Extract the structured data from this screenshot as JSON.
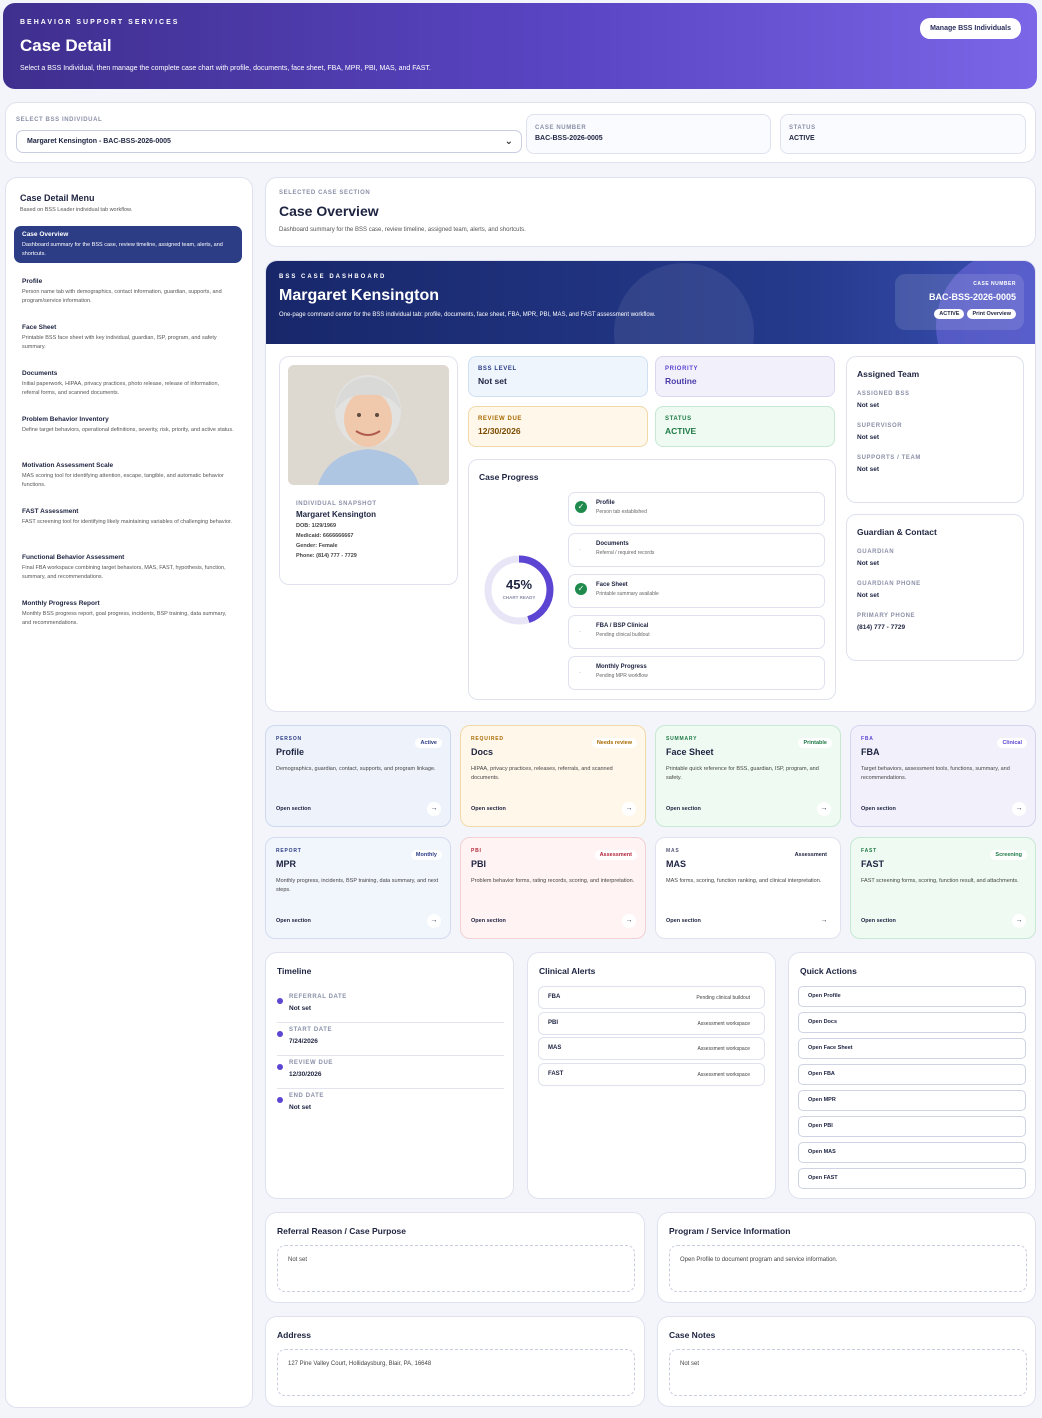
{
  "header": {
    "kicker": "BEHAVIOR SUPPORT SERVICES",
    "title": "Case Detail",
    "subtitle": "Select a BSS Individual, then manage the complete case chart with profile, documents, face sheet, FBA, MPR, PBI, MAS, and FAST.",
    "manage_button": "Manage BSS Individuals"
  },
  "selector": {
    "label": "SELECT BSS INDIVIDUAL",
    "value": "Margaret Kensington - BAC-BSS-2026-0005",
    "case_number_label": "CASE NUMBER",
    "case_number": "BAC-BSS-2026-0005",
    "status_label": "STATUS",
    "status": "ACTIVE"
  },
  "sidebar": {
    "title": "Case Detail Menu",
    "subtitle": "Based on BSS Leader individual tab workflow.",
    "items": [
      {
        "label": "Case Overview",
        "desc": "Dashboard summary for the BSS case, review timeline, assigned team, alerts, and shortcuts."
      },
      {
        "label": "Profile",
        "desc": "Person name tab with demographics, contact information, guardian, supports, and program/service information."
      },
      {
        "label": "Face Sheet",
        "desc": "Printable BSS face sheet with key individual, guardian, ISP, program, and safety summary."
      },
      {
        "label": "Documents",
        "desc": "Initial paperwork, HIPAA, privacy practices, photo release, release of information, referral forms, and scanned documents."
      },
      {
        "label": "Problem Behavior Inventory",
        "desc": "Define target behaviors, operational definitions, severity, risk, priority, and active status."
      },
      {
        "label": "Motivation Assessment Scale",
        "desc": "MAS scoring tool for identifying attention, escape, tangible, and automatic behavior functions."
      },
      {
        "label": "FAST Assessment",
        "desc": "FAST screening tool for identifying likely maintaining variables of challenging behavior."
      },
      {
        "label": "Functional Behavior Assessment",
        "desc": "Final FBA workspace combining target behaviors, MAS, FAST, hypothesis, function, summary, and recommendations."
      },
      {
        "label": "Monthly Progress Report",
        "desc": "Monthly BSS progress report, goal progress, incidents, BSP training, data summary, and recommendations."
      }
    ]
  },
  "overview": {
    "kicker": "SELECTED CASE SECTION",
    "title": "Case Overview",
    "desc": "Dashboard summary for the BSS case, review timeline, assigned team, alerts, and shortcuts."
  },
  "dashboard": {
    "kicker": "BSS CASE DASHBOARD",
    "name": "Margaret Kensington",
    "desc": "One-page command center for the BSS individual tab: profile, documents, face sheet, FBA, MPR, PBI, MAS, and FAST assessment workflow.",
    "case_number_label": "CASE NUMBER",
    "case_number": "BAC-BSS-2026-0005",
    "active_pill": "ACTIVE",
    "print_pill": "Print Overview"
  },
  "snapshot": {
    "label": "INDIVIDUAL SNAPSHOT",
    "name": "Margaret Kensington",
    "dob": "DOB: 1/29/1969",
    "medicaid": "Medicaid: 6666666667",
    "gender": "Gender: Female",
    "phone": "Phone: (814) 777 - 7729"
  },
  "stats": {
    "bss_level_label": "BSS LEVEL",
    "bss_level": "Not set",
    "priority_label": "PRIORITY",
    "priority": "Routine",
    "review_due_label": "REVIEW DUE",
    "review_due": "12/30/2026",
    "status_label": "STATUS",
    "status": "ACTIVE"
  },
  "progress": {
    "title": "Case Progress",
    "percent_text": "45%",
    "percent": 45,
    "caption": "CHART READY",
    "steps": [
      {
        "title": "Profile",
        "desc": "Person tab established",
        "done": true
      },
      {
        "title": "Documents",
        "desc": "Referral / required records",
        "done": false
      },
      {
        "title": "Face Sheet",
        "desc": "Printable summary available",
        "done": true
      },
      {
        "title": "FBA / BSP Clinical",
        "desc": "Pending clinical buildout",
        "done": false
      },
      {
        "title": "Monthly Progress",
        "desc": "Pending MPR workflow",
        "done": false
      }
    ]
  },
  "team": {
    "title": "Assigned Team",
    "rows": [
      {
        "label": "ASSIGNED BSS",
        "value": "Not set"
      },
      {
        "label": "SUPERVISOR",
        "value": "Not set"
      },
      {
        "label": "SUPPORTS / TEAM",
        "value": "Not set"
      }
    ]
  },
  "guardian": {
    "title": "Guardian & Contact",
    "rows": [
      {
        "label": "GUARDIAN",
        "value": "Not set"
      },
      {
        "label": "GUARDIAN PHONE",
        "value": "Not set"
      },
      {
        "label": "PRIMARY PHONE",
        "value": "(814) 777 - 7729"
      }
    ]
  },
  "tiles": [
    {
      "kicker": "PERSON",
      "name": "Profile",
      "badge": "Active",
      "desc": "Demographics, guardian, contact, supports, and program linkage.",
      "open": "Open section",
      "arrow": "→",
      "bg": "#eef3fb",
      "border": "#cdd8ee",
      "kc": "#2c3d85",
      "bc": "#2c3d85"
    },
    {
      "kicker": "REQUIRED",
      "name": "Docs",
      "badge": "Needs review",
      "desc": "HIPAA, privacy practices, releases, referrals, and scanned documents.",
      "open": "Open section",
      "arrow": "→",
      "bg": "#fff7ea",
      "border": "#f1d9a8",
      "kc": "#a86a00",
      "bc": "#a86a00"
    },
    {
      "kicker": "SUMMARY",
      "name": "Face Sheet",
      "badge": "Printable",
      "desc": "Printable quick reference for BSS, guardian, ISP, program, and safety.",
      "open": "Open section",
      "arrow": "→",
      "bg": "#eefaf2",
      "border": "#c7e8d3",
      "kc": "#1f7a45",
      "bc": "#1f7a45"
    },
    {
      "kicker": "FBA",
      "name": "FBA",
      "badge": "Clinical",
      "desc": "Target behaviors, assessment tools, functions, summary, and recommendations.",
      "open": "Open section",
      "arrow": "→",
      "bg": "#f2f1fb",
      "border": "#d6d3ef",
      "kc": "#5b45d2",
      "bc": "#5b45d2"
    },
    {
      "kicker": "REPORT",
      "name": "MPR",
      "badge": "Monthly",
      "desc": "Monthly progress, incidents, BSP training, data summary, and next steps.",
      "open": "Open section",
      "arrow": "→",
      "bg": "#f1f5fc",
      "border": "#d3dcee",
      "kc": "#2c3d85",
      "bc": "#2c3d85"
    },
    {
      "kicker": "PBI",
      "name": "PBI",
      "badge": "Assessment",
      "desc": "Problem behavior forms, rating records, scoring, and interpretation.",
      "open": "Open section",
      "arrow": "→",
      "bg": "#fff3f4",
      "border": "#f2d0d4",
      "kc": "#b3263a",
      "bc": "#b3263a"
    },
    {
      "kicker": "MAS",
      "name": "MAS",
      "badge": "Assessment",
      "desc": "MAS forms, scoring, function ranking, and clinical interpretation.",
      "open": "Open section",
      "arrow": "→",
      "bg": "#ffffff",
      "border": "#dfe2ee",
      "kc": "#555b75",
      "bc": "#1d2340"
    },
    {
      "kicker": "FAST",
      "name": "FAST",
      "badge": "Screening",
      "desc": "FAST screening forms, scoring, function result, and attachments.",
      "open": "Open section",
      "arrow": "→",
      "bg": "#eefaf2",
      "border": "#c7e8d3",
      "kc": "#1f7a45",
      "bc": "#1f7a45"
    }
  ],
  "timeline": {
    "title": "Timeline",
    "items": [
      {
        "label": "REFERRAL DATE",
        "value": "Not set"
      },
      {
        "label": "START DATE",
        "value": "7/24/2026"
      },
      {
        "label": "REVIEW DUE",
        "value": "12/30/2026"
      },
      {
        "label": "END DATE",
        "value": "Not set"
      }
    ]
  },
  "alerts": {
    "title": "Clinical Alerts",
    "items": [
      {
        "name": "FBA",
        "note": "Pending clinical buildout"
      },
      {
        "name": "PBI",
        "note": "Assessment workspace"
      },
      {
        "name": "MAS",
        "note": "Assessment workspace"
      },
      {
        "name": "FAST",
        "note": "Assessment workspace"
      }
    ]
  },
  "quick_actions": {
    "title": "Quick Actions",
    "items": [
      "Open Profile",
      "Open Docs",
      "Open Face Sheet",
      "Open FBA",
      "Open MPR",
      "Open PBI",
      "Open MAS",
      "Open FAST"
    ]
  },
  "referral": {
    "title": "Referral Reason / Case Purpose",
    "value": "Not set"
  },
  "program": {
    "title": "Program / Service Information",
    "value": "Open Profile to document program and service information."
  },
  "address": {
    "title": "Address",
    "value": "127 Pine Valley Court, Hollidaysburg, Blair, PA, 16648"
  },
  "notes": {
    "title": "Case Notes",
    "value": "Not set"
  }
}
